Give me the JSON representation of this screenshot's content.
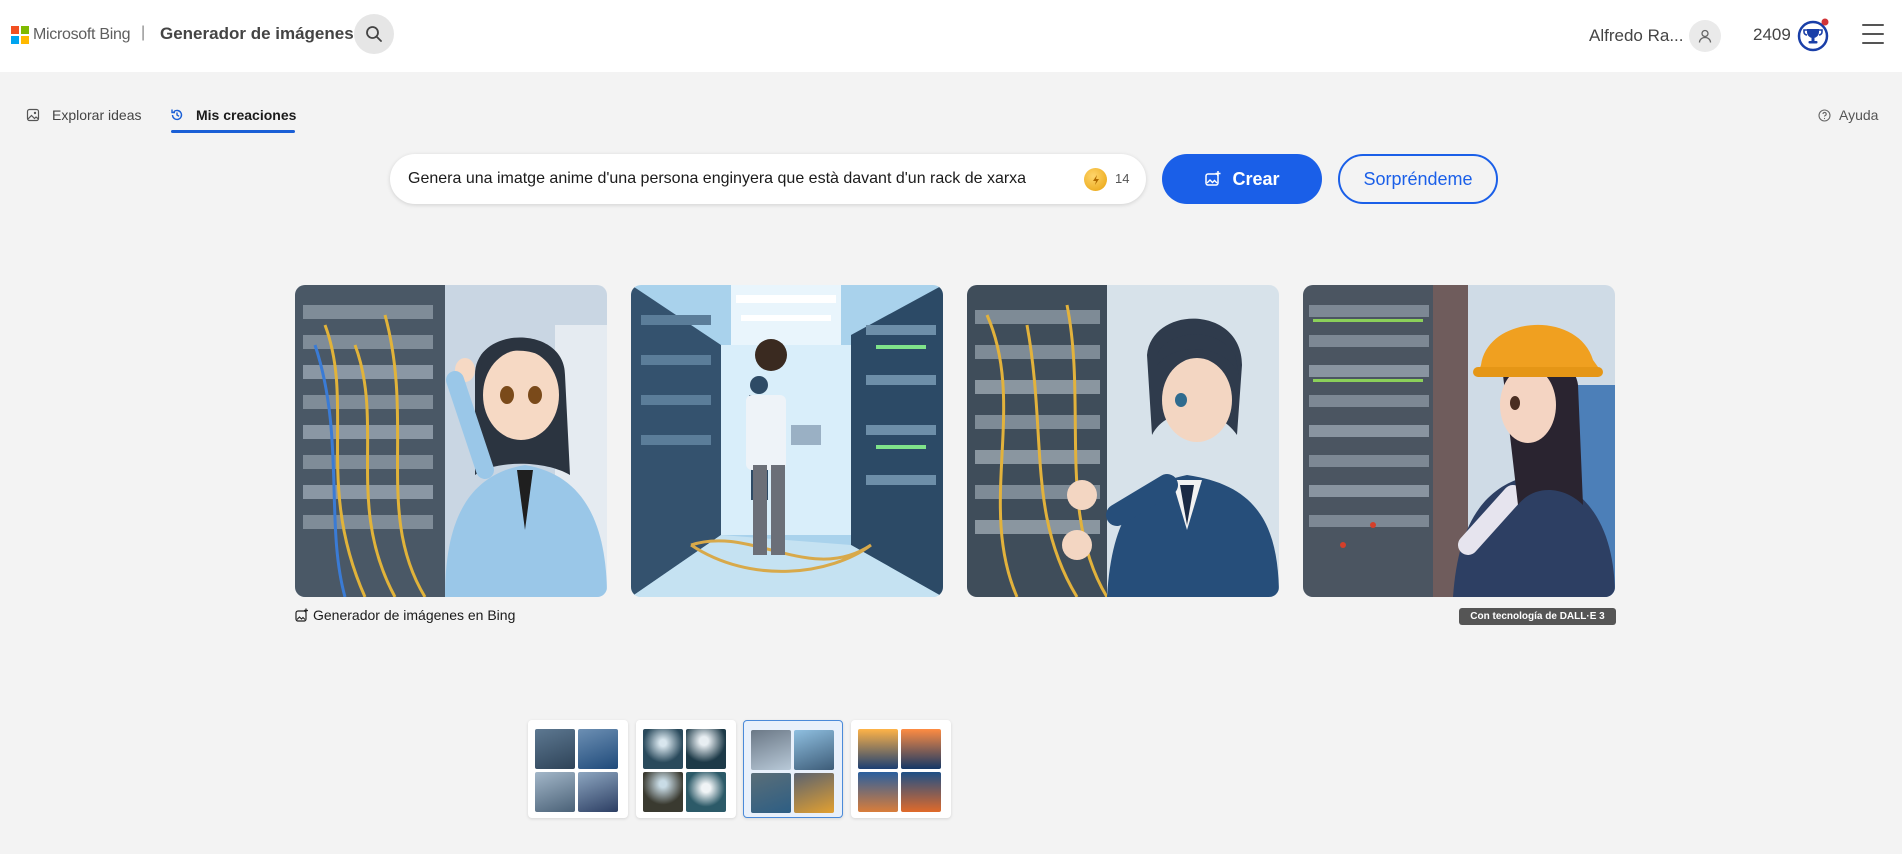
{
  "header": {
    "brand": "Microsoft Bing",
    "separator": "|",
    "product": "Generador de imágenes",
    "search_icon": "search-icon",
    "user_name": "Alfredo Ra...",
    "points": "2409",
    "rewards_icon": "rewards-trophy-icon",
    "menu_icon": "hamburger-menu-icon"
  },
  "tabs": {
    "explore": "Explorar ideas",
    "mine": "Mis creaciones",
    "help": "Ayuda"
  },
  "prompt": {
    "text": "Genera una imatge anime d'una persona enginyera que està davant d'un rack de xarxa",
    "boosts": "14",
    "create_label": "Crear",
    "surprise_label": "Sorpréndeme"
  },
  "results": {
    "caption": "Generador de imágenes en Bing",
    "badge": "Con tecnología de DALL·E 3"
  },
  "colors": {
    "accent": "#1a5fe8",
    "header_bg": "#ffffff",
    "page_bg": "#f3f3f3",
    "notification_dot": "#d13438"
  }
}
